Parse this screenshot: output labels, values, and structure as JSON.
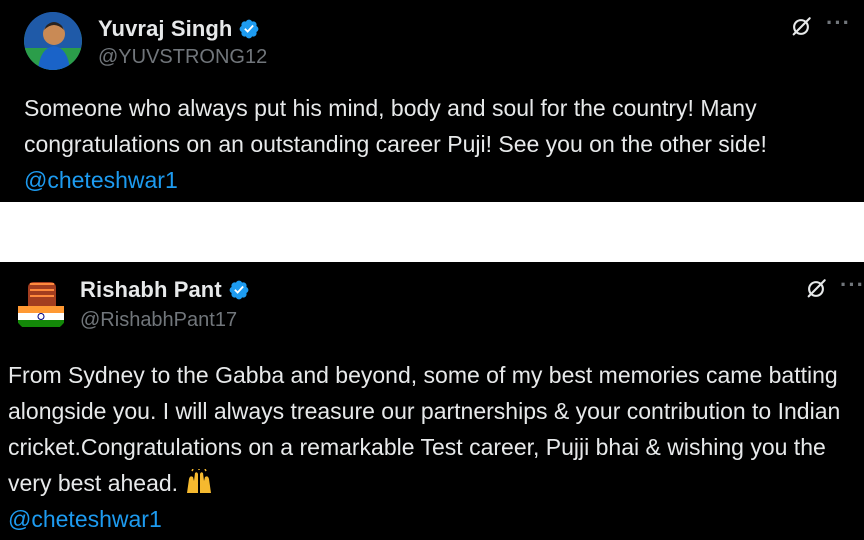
{
  "tweets": [
    {
      "display_name": "Yuvraj Singh",
      "handle": "@YUVSTRONG12",
      "text": "Someone who always put his mind, body and soul for the country! Many congratulations on an outstanding career Puji! See you on the other side!",
      "mention": "@cheteshwar1",
      "icons": [
        "avatar",
        "verified-badge-icon",
        "grok-icon",
        "more-icon"
      ]
    },
    {
      "display_name": "Rishabh Pant",
      "handle": "@RishabhPant17",
      "text": "From Sydney to the Gabba and beyond, some of my best memories came batting alongside you. I will always treasure our partnerships & your contribution to Indian cricket.Congratulations on a remarkable Test career, Pujji bhai & wishing you the very best ahead.",
      "emoji": "raising-hands-emoji",
      "mention": "@cheteshwar1",
      "icons": [
        "avatar",
        "verified-badge-icon",
        "grok-icon",
        "more-icon"
      ]
    }
  ],
  "more_glyph": "···",
  "colors": {
    "background": "#000000",
    "text": "#e7e9ea",
    "secondary": "#71767b",
    "mention": "#1d9bf0",
    "verified": "#1d9bf0"
  }
}
